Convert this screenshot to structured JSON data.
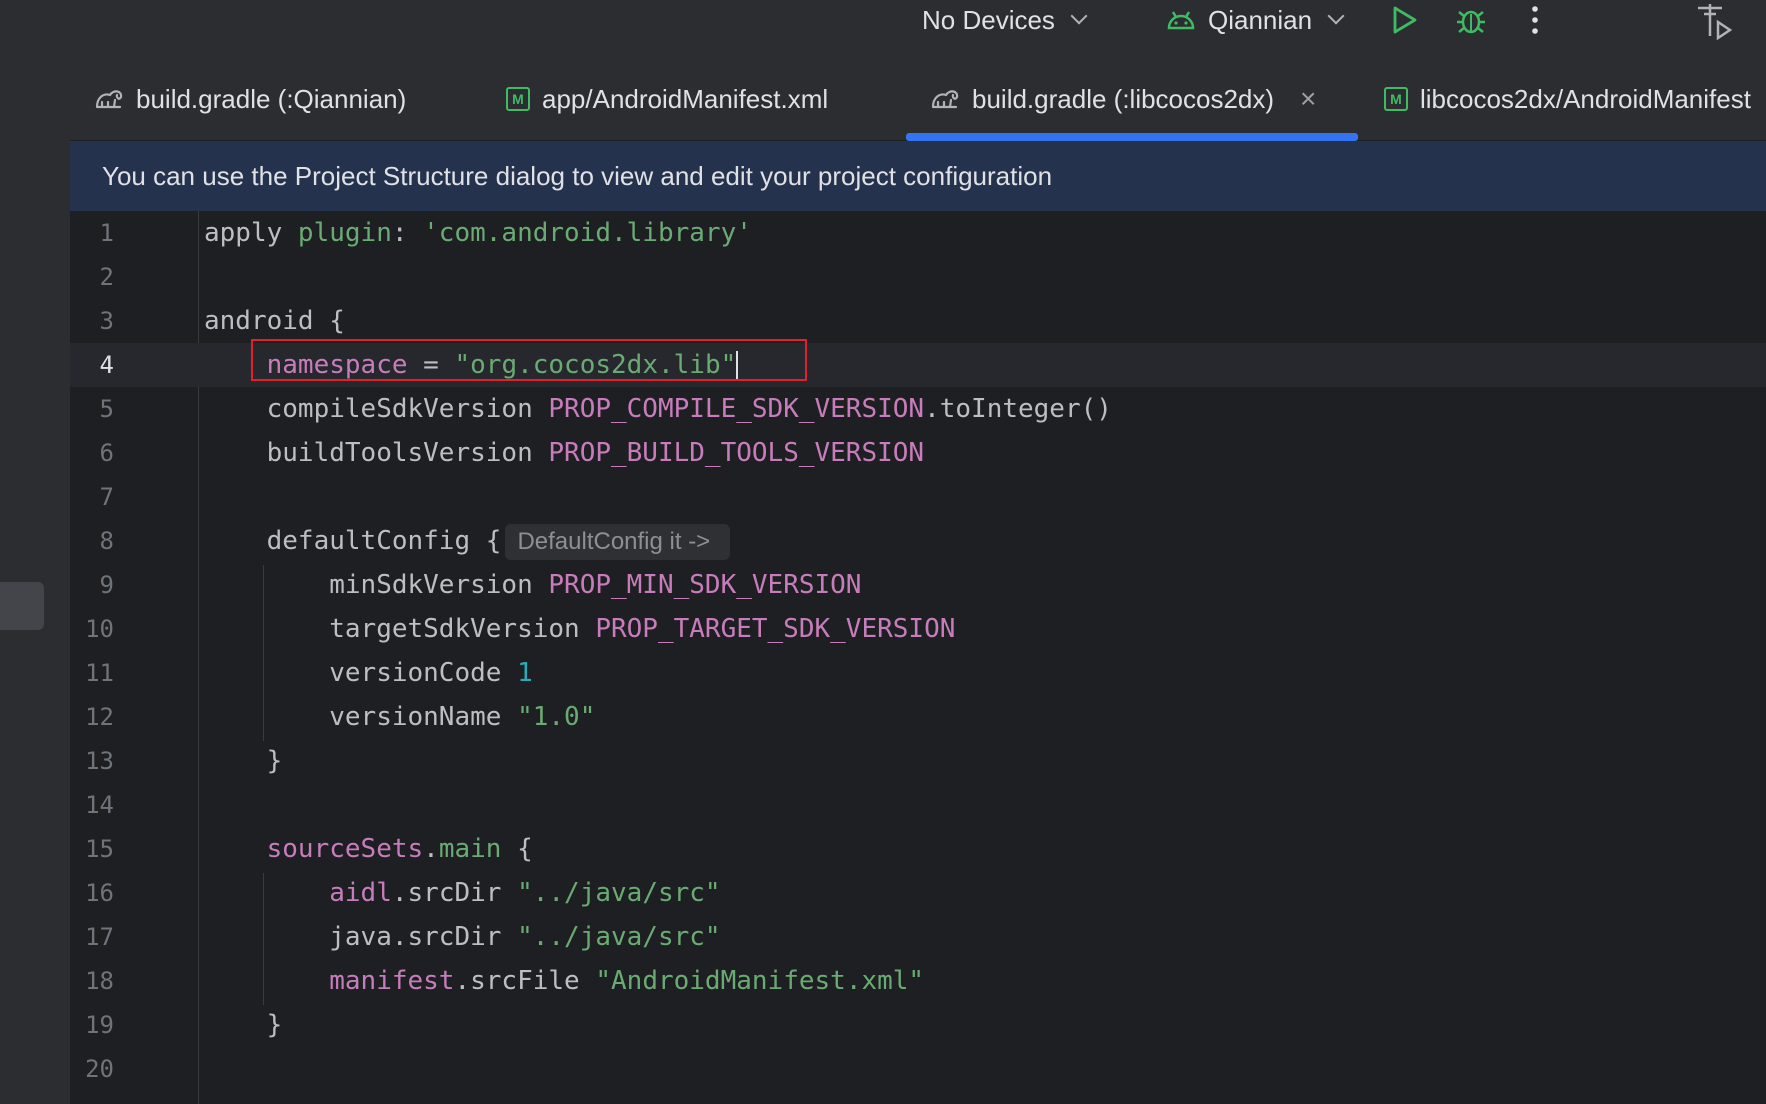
{
  "toolbar": {
    "devices_label": "No Devices",
    "config_label": "Qiannian"
  },
  "tabs": [
    {
      "label": "build.gradle (:Qiannian)",
      "icon": "gradle-icon"
    },
    {
      "label": "app/AndroidManifest.xml",
      "icon": "manifest-icon"
    },
    {
      "label": "build.gradle (:libcocos2dx)",
      "icon": "gradle-icon",
      "active": true
    },
    {
      "label": "libcocos2dx/AndroidManifest",
      "icon": "manifest-icon"
    }
  ],
  "banner": {
    "text": "You can use the Project Structure dialog to view and edit your project configuration"
  },
  "hint": {
    "text": "DefaultConfig it ->"
  },
  "editor": {
    "line_numbers": [
      "1",
      "2",
      "3",
      "4",
      "5",
      "6",
      "7",
      "8",
      "9",
      "10",
      "11",
      "12",
      "13",
      "14",
      "15",
      "16",
      "17",
      "18",
      "19",
      "20"
    ],
    "lines": {
      "l1": {
        "a": "apply ",
        "b": "plugin",
        "c": ": ",
        "d": "'com.android.library'"
      },
      "l3": {
        "a": "android {"
      },
      "l4": {
        "a": "namespace",
        "b": " = ",
        "c": "\"org.cocos2dx.lib\""
      },
      "l5": {
        "a": "compileSdkVersion ",
        "b": "PROP_COMPILE_SDK_VERSION",
        "c": ".toInteger()"
      },
      "l6": {
        "a": "buildToolsVersion ",
        "b": "PROP_BUILD_TOOLS_VERSION"
      },
      "l8": {
        "a": "defaultConfig {"
      },
      "l9": {
        "a": "minSdkVersion ",
        "b": "PROP_MIN_SDK_VERSION"
      },
      "l10": {
        "a": "targetSdkVersion ",
        "b": "PROP_TARGET_SDK_VERSION"
      },
      "l11": {
        "a": "versionCode ",
        "b": "1"
      },
      "l12": {
        "a": "versionName ",
        "b": "\"1.0\""
      },
      "l13": {
        "a": "}"
      },
      "l15": {
        "a": "sourceSets",
        "b": ".",
        "c": "main",
        "d": " {"
      },
      "l16": {
        "a": "aidl",
        "b": ".srcDir ",
        "c": "\"../java/src\""
      },
      "l17": {
        "a": "java.srcDir ",
        "b": "\"../java/src\""
      },
      "l18": {
        "a": "manifest",
        "b": ".srcFile ",
        "c": "\"AndroidManifest.xml\""
      },
      "l19": {
        "a": "}"
      }
    }
  },
  "colors": {
    "accent": "#3574f0",
    "highlight_box": "#e0202a",
    "string": "#6aab73",
    "property": "#c77dbb",
    "number": "#2aacb8"
  }
}
